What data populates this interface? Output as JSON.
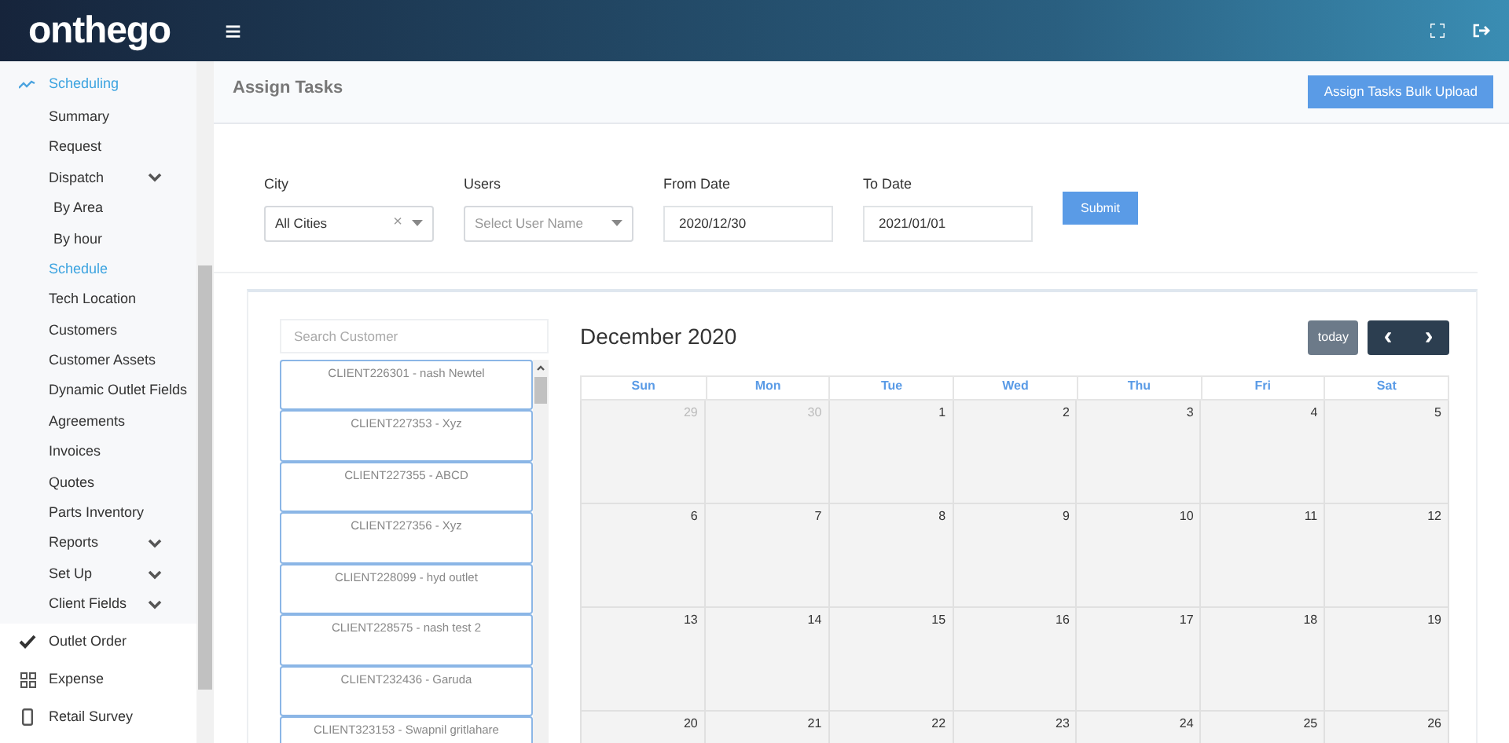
{
  "header": {
    "logo": "onthego",
    "menu_glyph": "≡"
  },
  "sidebar": {
    "sections": [
      {
        "label": "Scheduling",
        "selected": true,
        "children": [
          {
            "label": "Summary",
            "selected": false,
            "collapsible": false
          },
          {
            "label": "Request",
            "selected": false,
            "collapsible": false
          },
          {
            "label": "Dispatch",
            "selected": false,
            "collapsible": true,
            "children": [
              {
                "label": "By Area",
                "selected": false
              },
              {
                "label": "By hour",
                "selected": false
              }
            ]
          },
          {
            "label": "Schedule",
            "selected": true,
            "collapsible": false
          },
          {
            "label": "Tech Location",
            "selected": false,
            "collapsible": false
          },
          {
            "label": "Customers",
            "selected": false,
            "collapsible": false
          },
          {
            "label": "Customer Assets",
            "selected": false,
            "collapsible": false
          },
          {
            "label": "Dynamic Outlet Fields",
            "selected": false,
            "collapsible": false
          },
          {
            "label": "Agreements",
            "selected": false,
            "collapsible": false
          },
          {
            "label": "Invoices",
            "selected": false,
            "collapsible": false
          },
          {
            "label": "Quotes",
            "selected": false,
            "collapsible": false
          },
          {
            "label": "Parts Inventory",
            "selected": false,
            "collapsible": false
          },
          {
            "label": "Reports",
            "selected": false,
            "collapsible": true
          },
          {
            "label": "Set Up",
            "selected": false,
            "collapsible": true
          },
          {
            "label": "Client Fields",
            "selected": false,
            "collapsible": true
          }
        ]
      },
      {
        "label": "Outlet Order",
        "selected": false
      },
      {
        "label": "Expense",
        "selected": false
      },
      {
        "label": "Retail Survey",
        "selected": false
      }
    ]
  },
  "page": {
    "title": "Assign Tasks",
    "bulk_button": "Assign Tasks Bulk Upload"
  },
  "filters": [
    {
      "kind": "select",
      "label": "City",
      "value": "All Cities",
      "clear_glyph": "×"
    },
    {
      "kind": "select",
      "label": "Users",
      "placeholder": "Select User Name"
    },
    {
      "kind": "text",
      "label": "From Date",
      "value": "2020/12/30"
    },
    {
      "kind": "text",
      "label": "To Date",
      "value": "2021/01/01"
    }
  ],
  "submit": "Submit",
  "customers": {
    "placeholder": "Search Customer",
    "items": [
      "CLIENT226301 - nash Newtel",
      "CLIENT227353 - Xyz",
      "CLIENT227355 - ABCD",
      "CLIENT227356 - Xyz",
      "CLIENT228099 - hyd outlet",
      "CLIENT228575 - nash test 2",
      "CLIENT232436 - Garuda",
      "CLIENT323153 - Swapnil gritlahare"
    ]
  },
  "calendar": {
    "title": "December 2020",
    "today": "today",
    "prev": "‹",
    "next": "›",
    "weekdays": [
      "Sun",
      "Mon",
      "Tue",
      "Wed",
      "Thu",
      "Fri",
      "Sat"
    ],
    "days": [
      {
        "label": "29",
        "other_month": true
      },
      {
        "label": "30",
        "other_month": true
      },
      {
        "label": "1",
        "other_month": false
      },
      {
        "label": "2",
        "other_month": false
      },
      {
        "label": "3",
        "other_month": false
      },
      {
        "label": "4",
        "other_month": false
      },
      {
        "label": "5",
        "other_month": false
      },
      {
        "label": "6",
        "other_month": false
      },
      {
        "label": "7",
        "other_month": false
      },
      {
        "label": "8",
        "other_month": false
      },
      {
        "label": "9",
        "other_month": false
      },
      {
        "label": "10",
        "other_month": false
      },
      {
        "label": "11",
        "other_month": false
      },
      {
        "label": "12",
        "other_month": false
      },
      {
        "label": "13",
        "other_month": false
      },
      {
        "label": "14",
        "other_month": false
      },
      {
        "label": "15",
        "other_month": false
      },
      {
        "label": "16",
        "other_month": false
      },
      {
        "label": "17",
        "other_month": false
      },
      {
        "label": "18",
        "other_month": false
      },
      {
        "label": "19",
        "other_month": false
      },
      {
        "label": "20",
        "other_month": false
      },
      {
        "label": "21",
        "other_month": false
      },
      {
        "label": "22",
        "other_month": false
      },
      {
        "label": "23",
        "other_month": false
      },
      {
        "label": "24",
        "other_month": false
      },
      {
        "label": "25",
        "other_month": false
      },
      {
        "label": "26",
        "other_month": false
      }
    ]
  }
}
